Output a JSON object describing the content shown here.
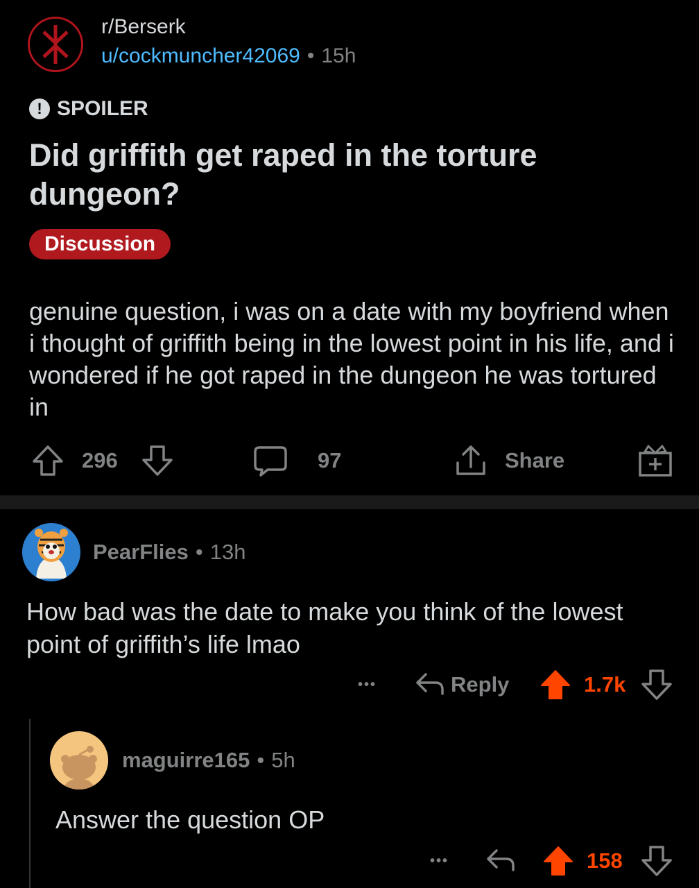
{
  "post": {
    "subreddit": "r/Berserk",
    "author": "u/cockmuncher42069",
    "separator": "•",
    "age": "15h",
    "spoiler_label": "SPOILER",
    "title": "Did griffith get raped in the torture dungeon?",
    "flair": "Discussion",
    "body": "genuine question, i was on a date with my boyfriend when i thought of griffith being in the lowest point in his life, and i wondered if he got raped in the dungeon he was tortured in",
    "score": "296",
    "comments": "97",
    "share_label": "Share",
    "icons": {
      "subreddit": "brand-of-sacrifice-icon",
      "spoiler": "exclamation-icon",
      "upvote": "arrow-up-icon",
      "downvote": "arrow-down-icon",
      "comments": "speech-bubble-icon",
      "share": "share-icon",
      "award": "gift-icon"
    }
  },
  "comments": [
    {
      "username": "PearFlies",
      "separator": "•",
      "age": "13h",
      "text": "How bad was the date to make you think of the lowest point of griffith’s life lmao",
      "more": "•••",
      "reply_label": "Reply",
      "score": "1.7k",
      "upvoted": true
    },
    {
      "username": "maguirre165",
      "separator": "•",
      "age": "5h",
      "text": "Answer the question OP",
      "more": "•••",
      "score": "158",
      "upvoted": true
    }
  ],
  "colors": {
    "background": "#000000",
    "text": "#d7dadc",
    "muted": "#818384",
    "link": "#4fbcff",
    "flair": "#b0191e",
    "upvote": "#ff4500",
    "subreddit_ring": "#b0141c"
  }
}
